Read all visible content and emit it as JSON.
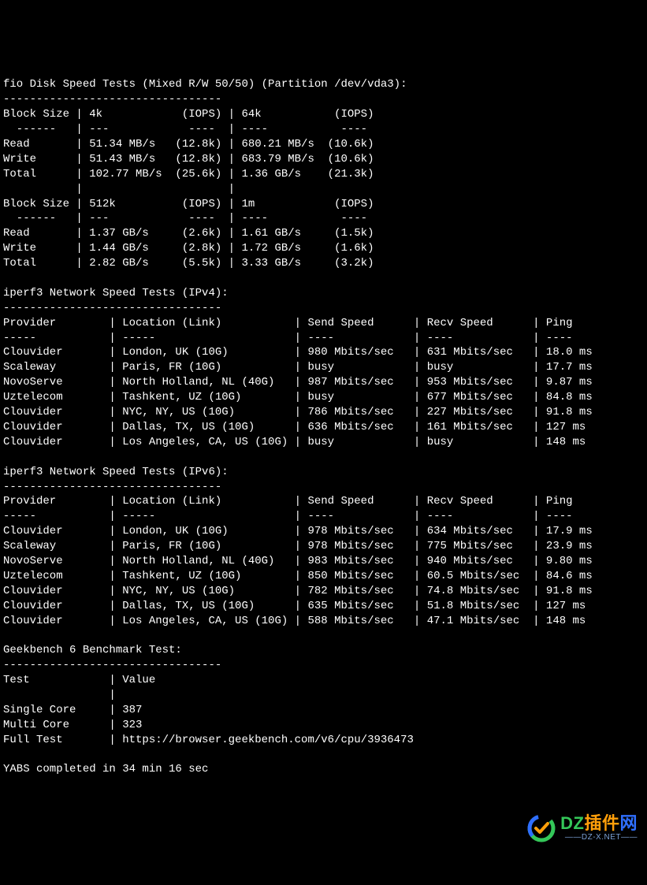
{
  "fio": {
    "header": "fio Disk Speed Tests (Mixed R/W 50/50) (Partition /dev/vda3):",
    "dashes": "---------------------------------",
    "table1": {
      "hdr": "Block Size | 4k            (IOPS) | 64k           (IOPS)",
      "sep": "  ------   | ---            ----  | ----           ----",
      "read": "Read       | 51.34 MB/s   (12.8k) | 680.21 MB/s  (10.6k)",
      "write": "Write      | 51.43 MB/s   (12.8k) | 683.79 MB/s  (10.6k)",
      "total": "Total      | 102.77 MB/s  (25.6k) | 1.36 GB/s    (21.3k)"
    },
    "blank": "           |                      |",
    "table2": {
      "hdr": "Block Size | 512k          (IOPS) | 1m            (IOPS)",
      "sep": "  ------   | ---            ----  | ----           ----",
      "read": "Read       | 1.37 GB/s     (2.6k) | 1.61 GB/s     (1.5k)",
      "write": "Write      | 1.44 GB/s     (2.8k) | 1.72 GB/s     (1.6k)",
      "total": "Total      | 2.82 GB/s     (5.5k) | 3.33 GB/s     (3.2k)"
    }
  },
  "ipv4": {
    "header": "iperf3 Network Speed Tests (IPv4):",
    "dashes": "---------------------------------",
    "hdr": "Provider        | Location (Link)           | Send Speed      | Recv Speed      | Ping",
    "sep": "-----           | -----                     | ----            | ----            | ----",
    "rows": [
      "Clouvider       | London, UK (10G)          | 980 Mbits/sec   | 631 Mbits/sec   | 18.0 ms",
      "Scaleway        | Paris, FR (10G)           | busy            | busy            | 17.7 ms",
      "NovoServe       | North Holland, NL (40G)   | 987 Mbits/sec   | 953 Mbits/sec   | 9.87 ms",
      "Uztelecom       | Tashkent, UZ (10G)        | busy            | 677 Mbits/sec   | 84.8 ms",
      "Clouvider       | NYC, NY, US (10G)         | 786 Mbits/sec   | 227 Mbits/sec   | 91.8 ms",
      "Clouvider       | Dallas, TX, US (10G)      | 636 Mbits/sec   | 161 Mbits/sec   | 127 ms",
      "Clouvider       | Los Angeles, CA, US (10G) | busy            | busy            | 148 ms"
    ]
  },
  "ipv6": {
    "header": "iperf3 Network Speed Tests (IPv6):",
    "dashes": "---------------------------------",
    "hdr": "Provider        | Location (Link)           | Send Speed      | Recv Speed      | Ping",
    "sep": "-----           | -----                     | ----            | ----            | ----",
    "rows": [
      "Clouvider       | London, UK (10G)          | 978 Mbits/sec   | 634 Mbits/sec   | 17.9 ms",
      "Scaleway        | Paris, FR (10G)           | 978 Mbits/sec   | 775 Mbits/sec   | 23.9 ms",
      "NovoServe       | North Holland, NL (40G)   | 983 Mbits/sec   | 940 Mbits/sec   | 9.80 ms",
      "Uztelecom       | Tashkent, UZ (10G)        | 850 Mbits/sec   | 60.5 Mbits/sec  | 84.6 ms",
      "Clouvider       | NYC, NY, US (10G)         | 782 Mbits/sec   | 74.8 Mbits/sec  | 91.8 ms",
      "Clouvider       | Dallas, TX, US (10G)      | 635 Mbits/sec   | 51.8 Mbits/sec  | 127 ms",
      "Clouvider       | Los Angeles, CA, US (10G) | 588 Mbits/sec   | 47.1 Mbits/sec  | 148 ms"
    ]
  },
  "geekbench": {
    "header": "Geekbench 6 Benchmark Test:",
    "dashes": "---------------------------------",
    "hdr": "Test            | Value",
    "blank": "                |",
    "single": "Single Core     | 387",
    "multi": "Multi Core      | 323",
    "full": "Full Test       | https://browser.geekbench.com/v6/cpu/3936473"
  },
  "footer": "YABS completed in 34 min 16 sec",
  "watermark": {
    "main_text": "DZ插件网",
    "sub_text": "——DZ-X.NET——"
  }
}
